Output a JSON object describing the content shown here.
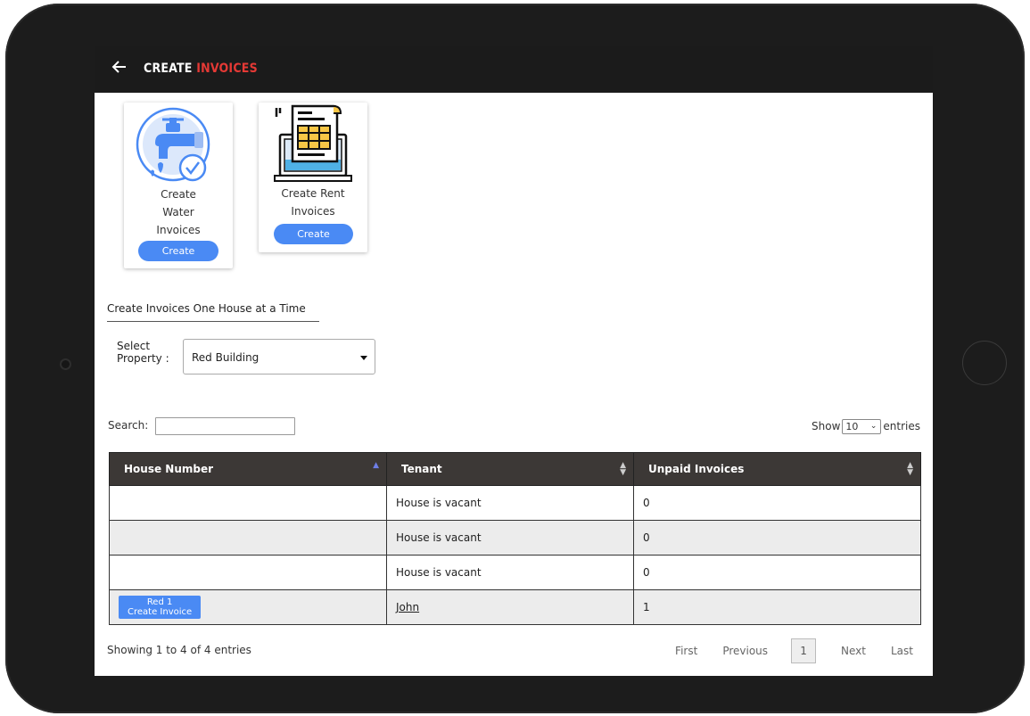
{
  "header": {
    "title_white": "CREATE",
    "title_red": "INVOICES",
    "back_icon": "arrow-left-icon"
  },
  "cards": [
    {
      "label": "Create Water Invoices",
      "label_lines": [
        "Create",
        "Water",
        "Invoices"
      ],
      "button": "Create",
      "icon": "water-tap-icon"
    },
    {
      "label": "Create Rent Invoices",
      "label_lines": [
        "Create Rent",
        "Invoices"
      ],
      "button": "Create",
      "icon": "rent-invoice-icon"
    }
  ],
  "single_house": {
    "title": "Create Invoices One House at a Time",
    "select_label_1": "Select",
    "select_label_2": "Property :",
    "selected_property": "Red Building"
  },
  "table_controls": {
    "search_label": "Search:",
    "search_value": "",
    "show_label": "Show",
    "entries_value": "10",
    "entries_label": "entries"
  },
  "table": {
    "columns": [
      "House Number",
      "Tenant",
      "Unpaid Invoices"
    ],
    "rows": [
      {
        "house": "",
        "tenant": "House is vacant",
        "unpaid": "0"
      },
      {
        "house": "",
        "tenant": "House is vacant",
        "unpaid": "0"
      },
      {
        "house": "",
        "tenant": "House is vacant",
        "unpaid": "0"
      },
      {
        "house": "Red 1",
        "house_action": "Create Invoice",
        "tenant": "John",
        "unpaid": "1"
      }
    ]
  },
  "footer": {
    "info": "Showing 1 to 4 of 4 entries",
    "pager": {
      "first": "First",
      "previous": "Previous",
      "current": "1",
      "next": "Next",
      "last": "Last"
    }
  },
  "colors": {
    "accent": "#4a8af4",
    "title_red": "#e53935",
    "header_bg": "#1b1b1b",
    "table_head": "#3c3836"
  }
}
